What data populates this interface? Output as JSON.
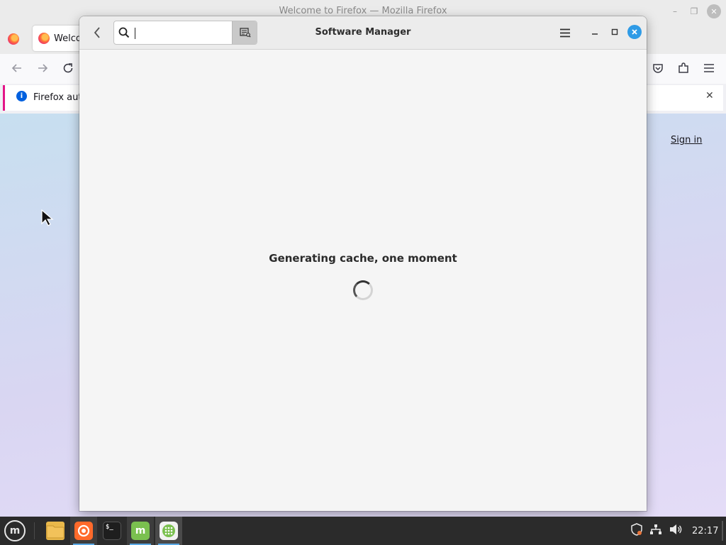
{
  "firefox": {
    "window_title": "Welcome to Firefox — Mozilla Firefox",
    "tab_label": "Welco",
    "notice_text": "Firefox auto",
    "sign_in": "Sign in"
  },
  "software_manager": {
    "title": "Software Manager",
    "search": {
      "value": "",
      "placeholder": ""
    },
    "loading_text": "Generating cache, one moment"
  },
  "taskbar": {
    "apps": [
      {
        "name": "Files",
        "icon": "folder-icon"
      },
      {
        "name": "Firefox",
        "icon": "firefox-icon",
        "active": true
      },
      {
        "name": "Terminal",
        "icon": "terminal-icon"
      },
      {
        "name": "Update Manager",
        "icon": "mint-update-icon",
        "active": true
      },
      {
        "name": "Software Manager",
        "icon": "software-manager-icon",
        "active": true,
        "focused": true
      }
    ],
    "clock": "22:17"
  },
  "colors": {
    "accent": "#2f9be6",
    "notice_border": "#e31587",
    "taskbar": "#2b2b2b"
  }
}
